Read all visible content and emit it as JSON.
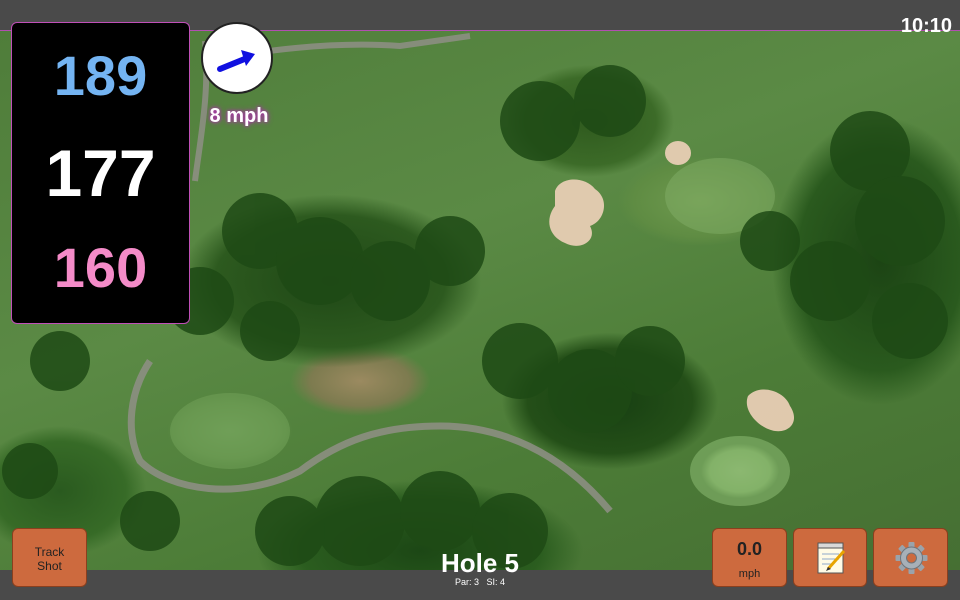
{
  "clock": {
    "time": "10:10"
  },
  "distances": {
    "back": "189",
    "middle": "177",
    "front": "160"
  },
  "wind": {
    "speed": "8 mph",
    "icon": "wind-arrow-icon"
  },
  "buttons": {
    "track_shot": "Track\nShot",
    "speed_value": "0.0",
    "speed_unit": "mph",
    "notes_icon": "notepad-icon",
    "settings_icon": "gear-icon"
  },
  "hole": {
    "title": "Hole 5",
    "par": "Par: 3",
    "si": "SI: 4"
  },
  "colors": {
    "back": "#74b4f2",
    "middle": "#ffffff",
    "front": "#f48bc8",
    "accent": "#c04fb8",
    "button": "#cd6a3e"
  }
}
